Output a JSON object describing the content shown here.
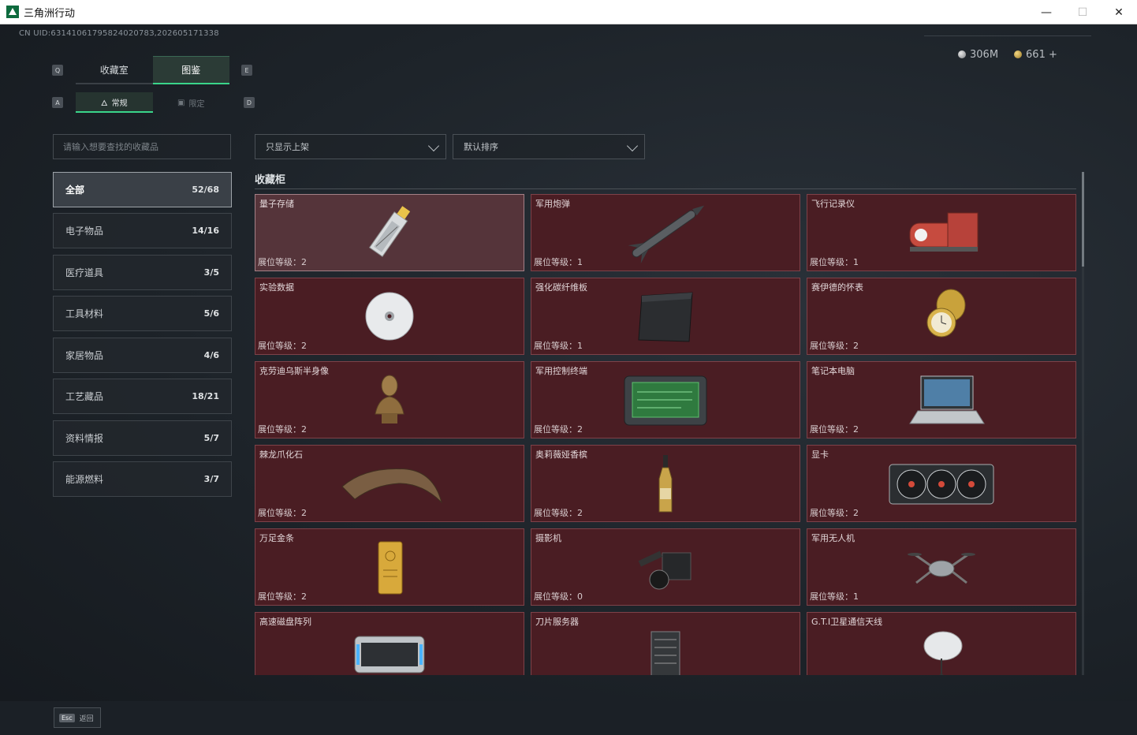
{
  "window": {
    "title": "三角洲行动"
  },
  "header": {
    "uid": "CN UID:6314106179582402078З,202605171338",
    "silver_amount": "306M",
    "gold_amount": "661",
    "gold_plus": "+"
  },
  "tabs": {
    "main": [
      {
        "label": "收藏室",
        "active": false
      },
      {
        "label": "图鉴",
        "active": true
      }
    ],
    "sub": [
      {
        "label": "常规",
        "active": true
      },
      {
        "label": "限定",
        "active": false
      }
    ],
    "key_hints": {
      "left_main": "Q",
      "right_main": "E",
      "left_sub": "A",
      "right_sub": "D"
    }
  },
  "search": {
    "placeholder": "请输入想要查找的收藏品"
  },
  "categories": [
    {
      "label": "全部",
      "count": "52/68",
      "active": true
    },
    {
      "label": "电子物品",
      "count": "14/16"
    },
    {
      "label": "医疗道具",
      "count": "3/5"
    },
    {
      "label": "工具材料",
      "count": "5/6"
    },
    {
      "label": "家居物品",
      "count": "4/6"
    },
    {
      "label": "工艺藏品",
      "count": "18/21"
    },
    {
      "label": "资料情报",
      "count": "5/7"
    },
    {
      "label": "能源燃料",
      "count": "3/7"
    }
  ],
  "filters": {
    "display": "只显示上架",
    "sort": "默认排序"
  },
  "section_title": "收藏柜",
  "items": [
    {
      "name": "量子存储",
      "level": "展位等级：2",
      "icon": "usb-drive-icon"
    },
    {
      "name": "军用炮弹",
      "level": "展位等级：1",
      "icon": "missile-icon"
    },
    {
      "name": "飞行记录仪",
      "level": "展位等级：1",
      "icon": "flight-recorder-icon"
    },
    {
      "name": "实验数据",
      "level": "展位等级：2",
      "icon": "disc-icon"
    },
    {
      "name": "强化碳纤维板",
      "level": "展位等级：1",
      "icon": "carbon-plate-icon"
    },
    {
      "name": "赛伊德的怀表",
      "level": "展位等级：2",
      "icon": "pocket-watch-icon"
    },
    {
      "name": "克劳迪乌斯半身像",
      "level": "展位等级：2",
      "icon": "bust-icon"
    },
    {
      "name": "军用控制终端",
      "level": "展位等级：2",
      "icon": "terminal-icon"
    },
    {
      "name": "笔记本电脑",
      "level": "展位等级：2",
      "icon": "laptop-icon"
    },
    {
      "name": "棘龙爪化石",
      "level": "展位等级：2",
      "icon": "claw-fossil-icon"
    },
    {
      "name": "奥莉薇娅香槟",
      "level": "展位等级：2",
      "icon": "champagne-icon"
    },
    {
      "name": "显卡",
      "level": "展位等级：2",
      "icon": "gpu-icon"
    },
    {
      "name": "万足金条",
      "level": "展位等级：2",
      "icon": "gold-bar-icon"
    },
    {
      "name": "摄影机",
      "level": "展位等级：0",
      "icon": "camera-icon"
    },
    {
      "name": "军用无人机",
      "level": "展位等级：1",
      "icon": "drone-icon"
    },
    {
      "name": "高速磁盘阵列",
      "level": "",
      "icon": "disk-array-icon"
    },
    {
      "name": "刀片服务器",
      "level": "",
      "icon": "blade-server-icon"
    },
    {
      "name": "G.T.I卫星通信天线",
      "level": "",
      "icon": "satellite-dish-icon"
    }
  ],
  "footer": {
    "esc_key": "Esc",
    "back_label": "返回"
  },
  "colors": {
    "accent": "#3ad58a",
    "card_bg": "#4a1d23",
    "card_border": "#7e4249"
  }
}
